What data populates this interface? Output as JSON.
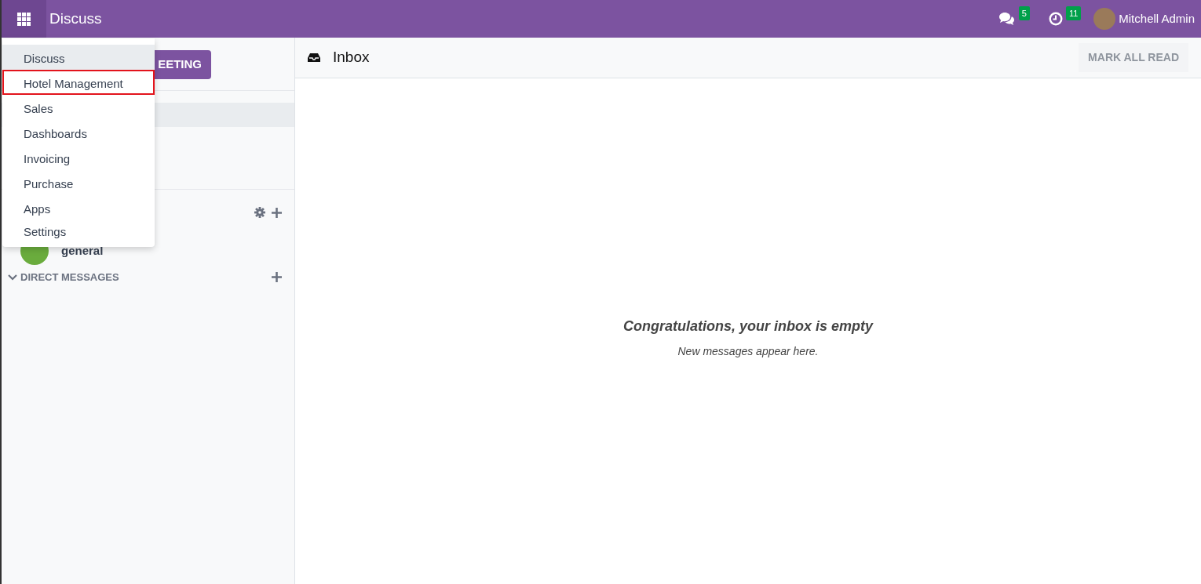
{
  "navbar": {
    "app_title": "Discuss",
    "menu_open": true,
    "systray": [
      {
        "kind": "chat",
        "badge": "5"
      },
      {
        "kind": "activity",
        "badge": "11"
      }
    ],
    "user": {
      "name": "Mitchell Admin"
    }
  },
  "apps_menu": [
    {
      "label": "Discuss",
      "hovered": true,
      "outlined": false
    },
    {
      "label": "Hotel Management",
      "hovered": false,
      "outlined": true
    },
    {
      "label": "Sales",
      "hovered": false,
      "outlined": false
    },
    {
      "label": "Dashboards",
      "hovered": false,
      "outlined": false
    },
    {
      "label": "Invoicing",
      "hovered": false,
      "outlined": false
    },
    {
      "label": "Purchase",
      "hovered": false,
      "outlined": false
    },
    {
      "label": "Apps",
      "hovered": false,
      "outlined": false
    },
    {
      "label": "Settings",
      "hovered": false,
      "outlined": false
    }
  ],
  "sidebar": {
    "meeting_button": "EETING",
    "channels": [
      {
        "name": "general"
      }
    ],
    "direct_messages": {
      "label": "DIRECT MESSAGES",
      "expanded": true
    }
  },
  "main": {
    "title": "Inbox",
    "mark_all_read": {
      "label": "MARK ALL READ",
      "disabled": true
    },
    "empty_title": "Congratulations, your inbox is empty",
    "empty_text": "New messages appear here."
  }
}
